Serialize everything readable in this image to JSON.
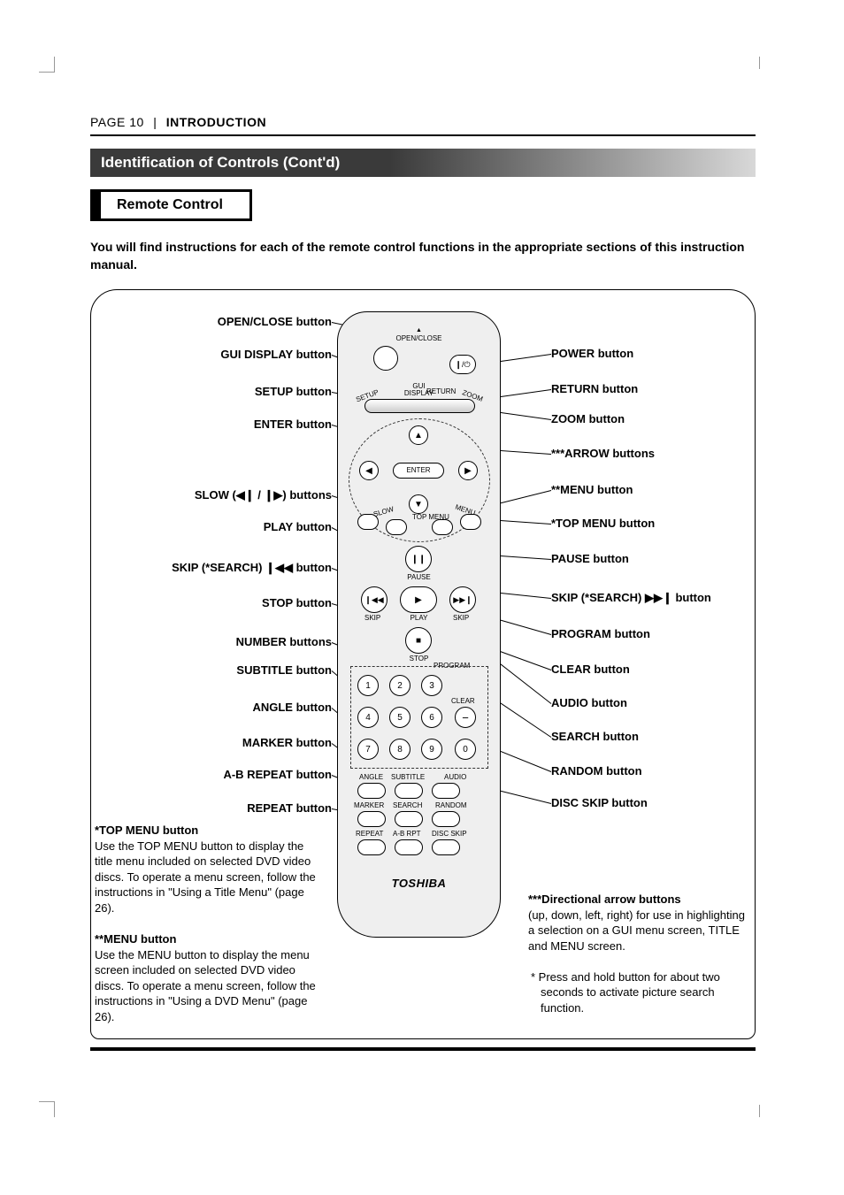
{
  "page": {
    "number_label": "PAGE 10",
    "section": "INTRODUCTION"
  },
  "section_title": "Identification of Controls (Cont'd)",
  "sub_title": "Remote Control",
  "intro": "You will find instructions for each of the remote control functions in the appropriate sections of this instruction manual.",
  "left_labels": [
    "OPEN/CLOSE button",
    "GUI DISPLAY button",
    "SETUP button",
    "ENTER button",
    "SLOW (◀❙ / ❙▶) buttons",
    "PLAY button",
    "SKIP (*SEARCH) ❙◀◀ button",
    "STOP button",
    "NUMBER buttons",
    "SUBTITLE button",
    "ANGLE button",
    "MARKER button",
    "A-B REPEAT button",
    "REPEAT button"
  ],
  "right_labels": [
    "POWER button",
    "RETURN button",
    "ZOOM button",
    "***ARROW buttons",
    "**MENU button",
    "*TOP MENU button",
    "PAUSE button",
    "SKIP (*SEARCH) ▶▶❙ button",
    "PROGRAM button",
    "CLEAR button",
    "AUDIO button",
    "SEARCH button",
    "RANDOM button",
    "DISC SKIP button"
  ],
  "remote_labels": {
    "open_close": "OPEN/CLOSE",
    "gui_display": "GUI\nDISPLAY",
    "setup": "SETUP",
    "return": "RETURN",
    "zoom": "ZOOM",
    "enter": "ENTER",
    "slow": "SLOW",
    "top_menu": "TOP MENU",
    "menu": "MENU",
    "pause": "PAUSE",
    "skip_l": "SKIP",
    "play": "PLAY",
    "skip_r": "SKIP",
    "stop": "STOP",
    "program": "PROGRAM",
    "clear": "CLEAR",
    "angle": "ANGLE",
    "subtitle": "SUBTITLE",
    "audio": "AUDIO",
    "marker": "MARKER",
    "search": "SEARCH",
    "random": "RANDOM",
    "repeat": "REPEAT",
    "ab_rpt": "A-B RPT",
    "disc_skip": "DISC SKIP"
  },
  "numbers": [
    "1",
    "2",
    "3",
    "4",
    "5",
    "6",
    "7",
    "8",
    "9",
    "0"
  ],
  "brand": "TOSHIBA",
  "footnotes": {
    "top_menu_title": "*TOP MENU button",
    "top_menu_body": "Use the TOP MENU button to display the title menu included on selected DVD video discs. To operate a menu screen, follow the instructions in \"Using a Title Menu\" (page 26).",
    "menu_title": "**MENU button",
    "menu_body": "Use the MENU button to display the menu screen included on selected DVD video discs. To operate a menu screen, follow the instructions in \"Using a DVD Menu\" (page 26).",
    "arrow_title": "***Directional arrow buttons",
    "arrow_body": "(up, down, left, right) for use in highlighting a selection on a GUI menu screen, TITLE and MENU screen.",
    "search_note": "* Press and hold button for about two seconds to activate picture search function."
  }
}
